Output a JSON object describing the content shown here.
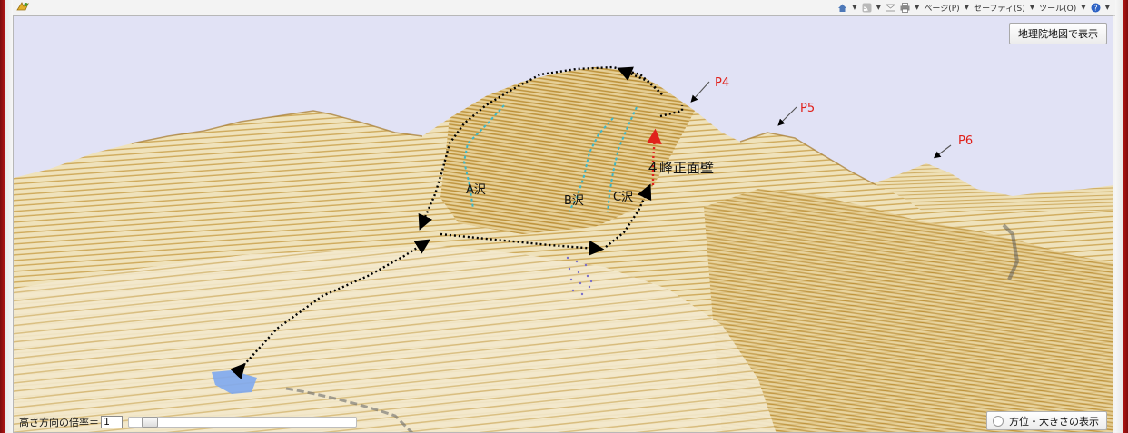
{
  "toolbar": {
    "page_label": "ページ(P)",
    "safety_label": "セーフティ(S)",
    "tools_label": "ツール(O)"
  },
  "map": {
    "gsi_button_label": "地理院地図で表示",
    "annotations": {
      "p4": "P4",
      "p5": "P5",
      "p6": "P6",
      "a_sawa": "A沢",
      "b_sawa": "B沢",
      "c_sawa": "C沢",
      "face": "４峰正面壁"
    },
    "height_ratio_label": "高さ方向の倍率＝",
    "height_ratio_value": "1",
    "orientation_button_label": "方位・大きさの表示"
  },
  "colors": {
    "sky": "#e1e2f5",
    "terrain_light": "#efe1b9",
    "terrain_dark": "#c49a3c",
    "route": "#000000",
    "stream": "#3fb7c9",
    "red_arrow": "#e0211b",
    "label_red": "#e0211b",
    "water": "#7ea9ef"
  },
  "icons": [
    "favorites-icon",
    "home-icon",
    "rss-icon",
    "mail-icon",
    "print-icon",
    "help-icon"
  ]
}
